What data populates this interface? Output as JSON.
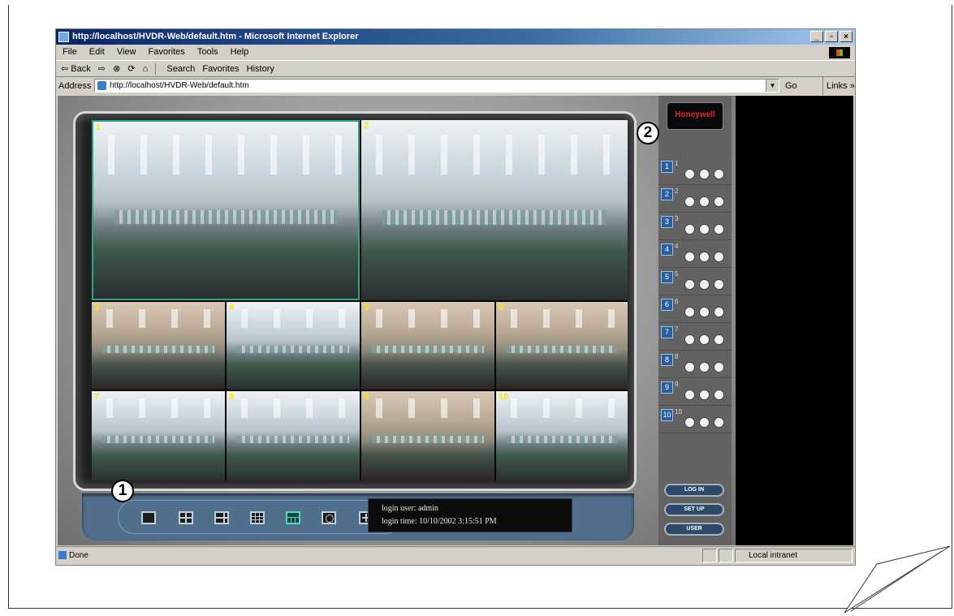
{
  "window": {
    "title": "http://localhost/HVDR-Web/default.htm - Microsoft Internet Explorer",
    "controls": [
      "_",
      "▫",
      "×"
    ]
  },
  "menu": [
    "File",
    "Edit",
    "View",
    "Favorites",
    "Tools",
    "Help"
  ],
  "toolbar": {
    "back": "⇦ Back",
    "forward": "⇨",
    "stop": "⊗",
    "refresh": "⟳",
    "home": "⌂",
    "search": "Search",
    "favorites": "Favorites",
    "history": "History"
  },
  "address": {
    "label": "Address",
    "url": "http://localhost/HVDR-Web/default.htm",
    "go": "Go",
    "links": "Links »"
  },
  "cameras": [
    "1",
    "2",
    "3",
    "4",
    "5",
    "6",
    "7",
    "8",
    "9",
    "10"
  ],
  "active_camera": "1",
  "login": {
    "user": "login user: admin",
    "time": "login time: 10/10/2002 3:15:51 PM"
  },
  "brand": "Honeywell",
  "channels": [
    "1",
    "2",
    "3",
    "4",
    "5",
    "6",
    "7",
    "8",
    "9",
    "10"
  ],
  "side_buttons": {
    "login": "LOG IN",
    "setup": "SET UP",
    "user": "USER"
  },
  "status": {
    "left": "Done",
    "zone": "Local intranet"
  },
  "markers": {
    "one": "1",
    "two": "2"
  }
}
